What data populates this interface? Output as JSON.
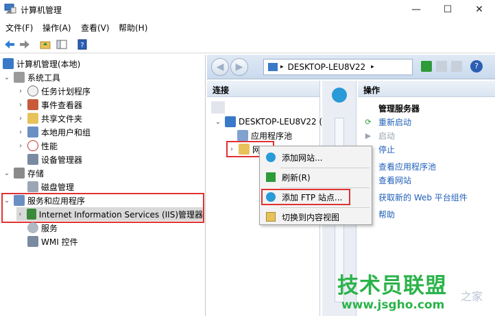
{
  "window": {
    "title": "计算机管理",
    "min_glyph": "—",
    "max_glyph": "☐",
    "close_glyph": "✕"
  },
  "menu": [
    "文件(F)",
    "操作(A)",
    "查看(V)",
    "帮助(H)"
  ],
  "tree": {
    "root": "计算机管理(本地)",
    "system_tools": "系统工具",
    "task_scheduler": "任务计划程序",
    "event_viewer": "事件查看器",
    "shared_folders": "共享文件夹",
    "local_users": "本地用户和组",
    "performance": "性能",
    "device_manager": "设备管理器",
    "storage": "存储",
    "disk_management": "磁盘管理",
    "services_apps": "服务和应用程序",
    "iis_manager": "Internet Information Services (IIS)管理器",
    "services": "服务",
    "wmi_control": "WMI 控件"
  },
  "iis": {
    "address": "DESKTOP-LEU8V22",
    "connections_header": "连接",
    "server_node": "DESKTOP-LEU8V22 (",
    "app_pools": "应用程序池",
    "sites": "网站"
  },
  "actions": {
    "header": "操作",
    "manage_server": "管理服务器",
    "restart": "重新启动",
    "start": "启动",
    "stop": "停止",
    "view_app_pools": "查看应用程序池",
    "view_sites": "查看网站",
    "get_web_platform": "获取新的 Web 平台组件",
    "help": "帮助"
  },
  "context_menu": {
    "add_website": "添加网站...",
    "refresh": "刷新(R)",
    "add_ftp": "添加 FTP 站点...",
    "switch_content_view": "切换到内容视图"
  },
  "watermark": {
    "big": "技术员联盟",
    "small": "www.jsgho.com",
    "tail": "之家"
  },
  "colors": {
    "highlight_box": "#e03030",
    "link": "#1f5fb8",
    "watermark": "#2bb34a"
  }
}
